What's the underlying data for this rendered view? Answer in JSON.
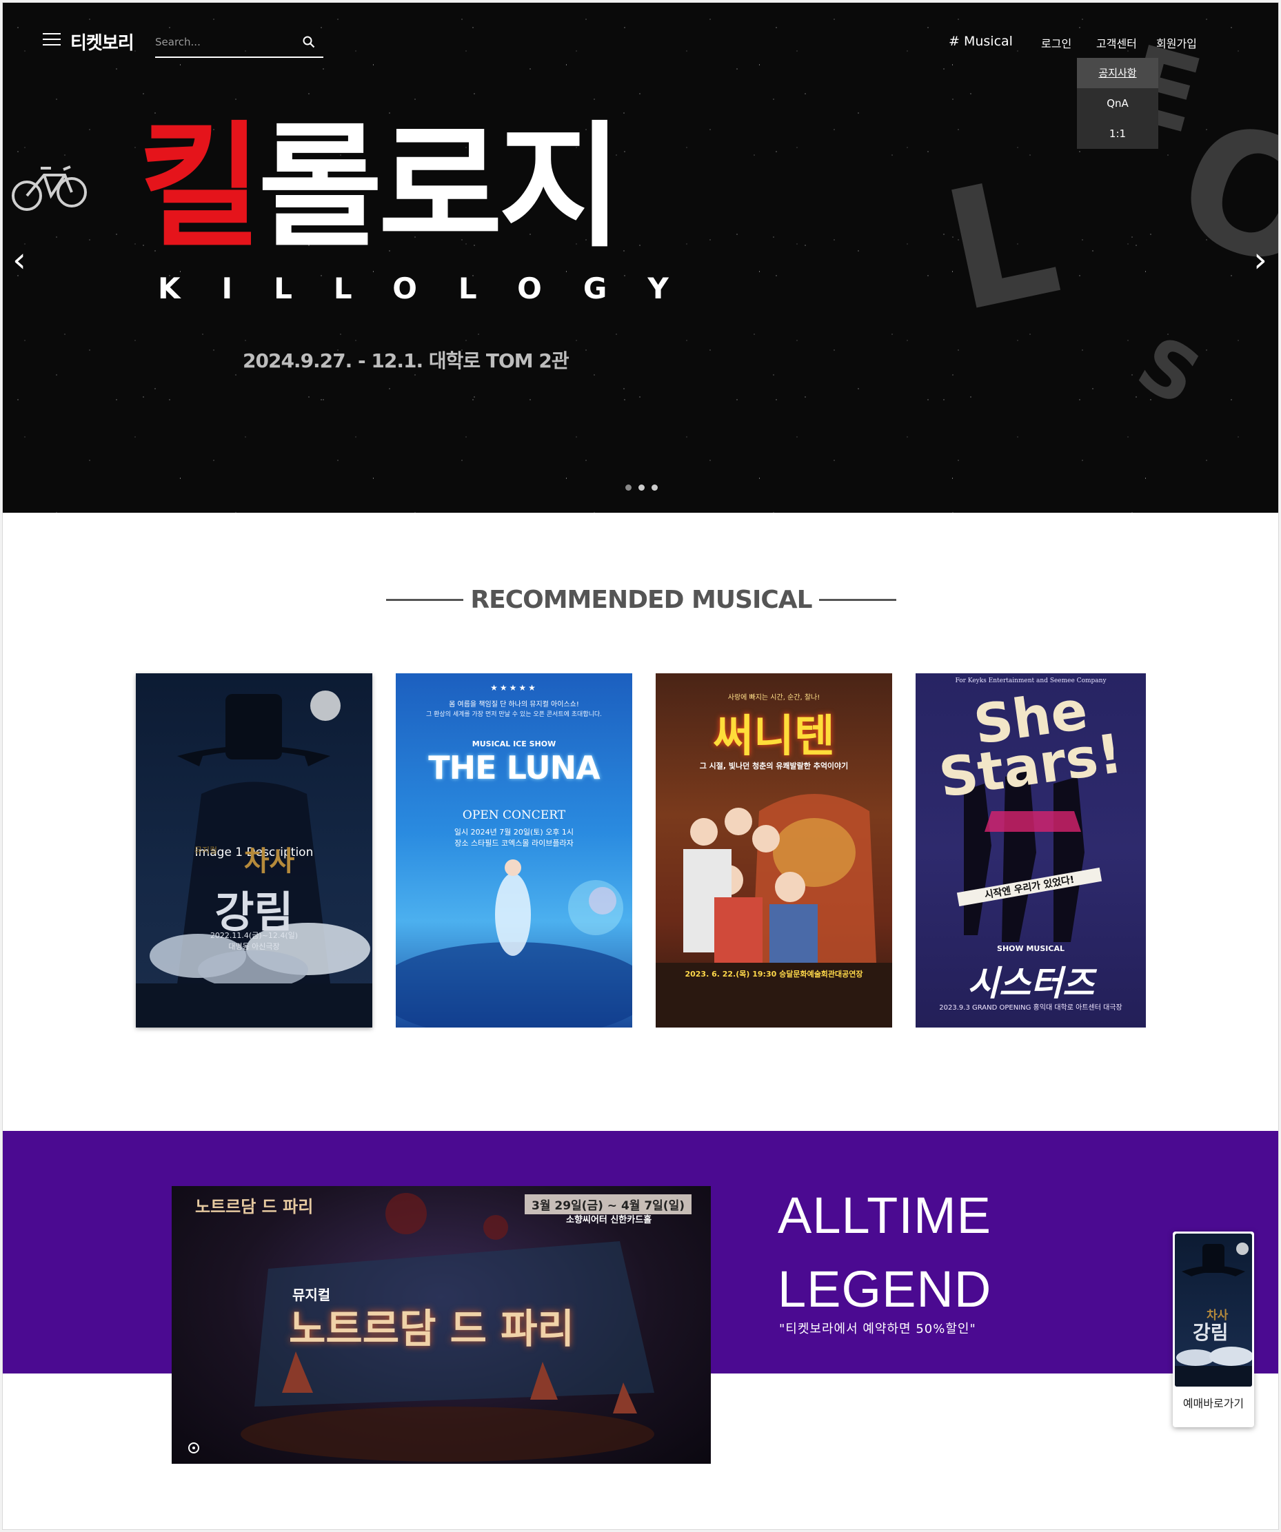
{
  "header": {
    "logo": "티켓보리",
    "search_placeholder": "Search...",
    "nav": {
      "musical": "# Musical",
      "login": "로그인",
      "customer_center": "고객센터",
      "signup": "회원가입"
    },
    "dropdown": [
      "공지사항",
      "QnA",
      "1:1"
    ]
  },
  "hero": {
    "title_red": "킬",
    "title_white": "롤로지",
    "title_eng": "KILLOLOGY",
    "date_venue": "2024.9.27. - 12.1. 대학로 TOM 2관",
    "prev_arrow": "‹",
    "next_arrow": "›"
  },
  "recommended": {
    "title": "RECOMMENDED MUSICAL",
    "posters": [
      {
        "overlay": "Image 1 Description",
        "small_title": "뮤지컬",
        "title_line1": "차사",
        "title_line2": "강림",
        "date": "2022.11.4(금)~12.4(일)",
        "venue": "대명동 아신극장"
      },
      {
        "stars": "★★★★★",
        "tagline1": "몸 여름을 책임질 단 하나의 뮤지컬 아이스쇼!",
        "tagline2": "그 환상의 세계를 가장 먼저 만날 수 있는 오픈 콘서트에 초대합니다.",
        "label": "MUSICAL ICE SHOW",
        "title": "THE LUNA",
        "subtitle": "OPEN CONCERT",
        "info1": "일시  2024년 7월 20일(토) 오후 1시",
        "info2": "장소  스타필드 코엑스몰 라이브플라자"
      },
      {
        "tagline": "사랑에 빠지는 시간, 순간, 찰나!",
        "title": "써니텐",
        "subtitle": "그 시절, 빛나던 청춘의 유쾌발랄한 추억이야기",
        "date": "2023. 6. 22.(목) 19:30  승달문화예술회관대공연장"
      },
      {
        "company": "For Keyks Entertainment and Seemee Company",
        "title_en1": "She",
        "title_en2": "Stars!",
        "tagline": "시작엔 우리가 있었다!",
        "label": "SHOW MUSICAL",
        "title": "시스터즈",
        "footer": "2023.9.3 GRAND OPENING 홍익대 대학로 아트센터 대극장"
      }
    ]
  },
  "legend": {
    "video": {
      "logo": "노트르담 드 파리",
      "date": "3월 29일(금) ~ 4월 7일(일)",
      "venue": "소향씨어터 신한카드홀",
      "small": "뮤지컬",
      "title": "노트르담 드 파리"
    },
    "title_line1": "ALLTIME",
    "title_line2": "LEGEND",
    "subtitle": "\"티켓보라에서 예약하면 50%할인\""
  },
  "float_booking": {
    "title_line1": "차사",
    "title_line2": "강림",
    "label": "예매바로가기"
  },
  "colors": {
    "accent_red": "#e5141b",
    "band_purple": "#4b0a91",
    "hero_bg": "#0a0a0a"
  }
}
